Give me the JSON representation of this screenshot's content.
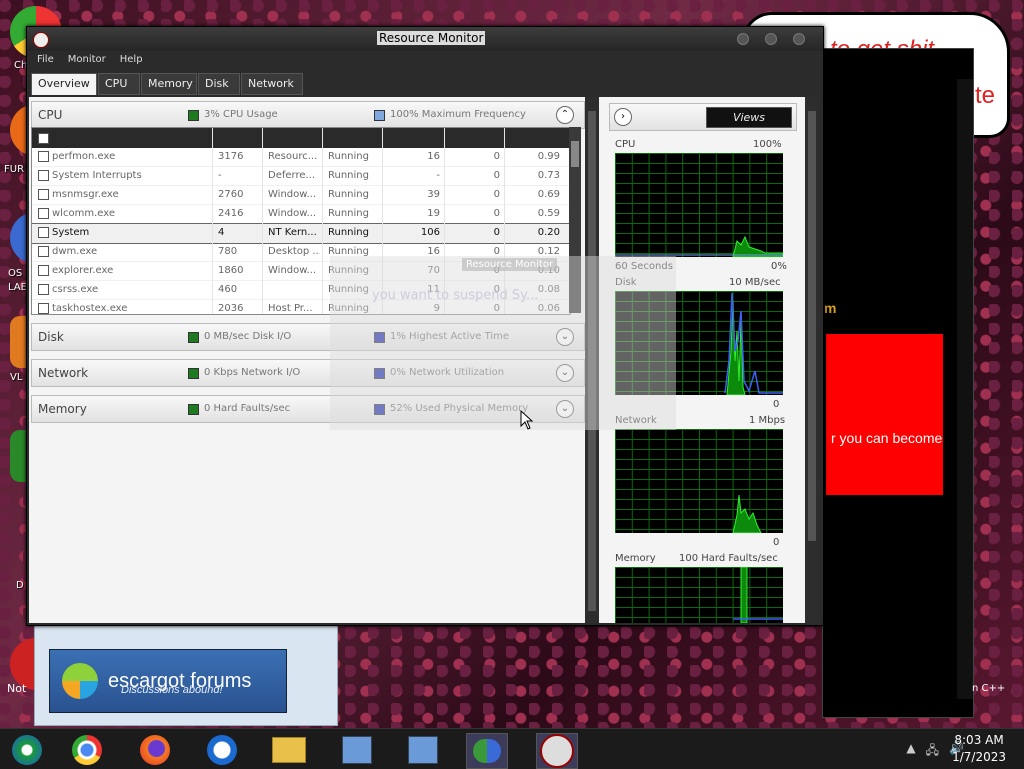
{
  "desktop": {
    "labels": [
      "Ch",
      "FUR",
      "OS",
      "LAE",
      "VL",
      "D",
      "Not"
    ],
    "speech_text": "to get shit",
    "speech_te": "te",
    "yellow_text": "m",
    "red_box_text": "r you can become",
    "forum_title": "escargot forums",
    "forum_subtitle": "Discussions abound!",
    "cpp_label": "n C++"
  },
  "window": {
    "title": "Resource Monitor",
    "menu": [
      "File",
      "Monitor",
      "Help"
    ],
    "tabs": [
      "Overview",
      "CPU",
      "Memory",
      "Disk",
      "Network"
    ],
    "active_tab": "Overview"
  },
  "cpu_section": {
    "name": "CPU",
    "stat1": "3% CPU Usage",
    "stat1_color": "#1e7a1e",
    "stat2": "100% Maximum Frequency",
    "stat2_color": "#7fa8e0"
  },
  "processes": [
    {
      "name": "perfmon.exe",
      "pid": "3176",
      "desc": "Resourc...",
      "status": "Running",
      "threads": "16",
      "cpu": "0",
      "avg": "0.99"
    },
    {
      "name": "System Interrupts",
      "pid": "-",
      "desc": "Deferre...",
      "status": "Running",
      "threads": "-",
      "cpu": "0",
      "avg": "0.73"
    },
    {
      "name": "msnmsgr.exe",
      "pid": "2760",
      "desc": "Window...",
      "status": "Running",
      "threads": "39",
      "cpu": "0",
      "avg": "0.69"
    },
    {
      "name": "wlcomm.exe",
      "pid": "2416",
      "desc": "Window...",
      "status": "Running",
      "threads": "19",
      "cpu": "0",
      "avg": "0.59"
    },
    {
      "name": "System",
      "pid": "4",
      "desc": "NT Kern...",
      "status": "Running",
      "threads": "106",
      "cpu": "0",
      "avg": "0.20"
    },
    {
      "name": "dwm.exe",
      "pid": "780",
      "desc": "Desktop ...",
      "status": "Running",
      "threads": "16",
      "cpu": "0",
      "avg": "0.12"
    },
    {
      "name": "explorer.exe",
      "pid": "1860",
      "desc": "Window...",
      "status": "Running",
      "threads": "70",
      "cpu": "0",
      "avg": "0.10"
    },
    {
      "name": "csrss.exe",
      "pid": "460",
      "desc": "",
      "status": "Running",
      "threads": "11",
      "cpu": "0",
      "avg": "0.08"
    },
    {
      "name": "taskhostex.exe",
      "pid": "2036",
      "desc": "Host Pr...",
      "status": "Running",
      "threads": "9",
      "cpu": "0",
      "avg": "0.06"
    }
  ],
  "disk_section": {
    "name": "Disk",
    "stat1": "0 MB/sec Disk I/O",
    "stat1_color": "#1e7a1e",
    "stat2": "1% Highest Active Time",
    "stat2_color": "#1a2ab0"
  },
  "network_section": {
    "name": "Network",
    "stat1": "0 Kbps Network I/O",
    "stat1_color": "#1e7a1e",
    "stat2": "0% Network Utilization",
    "stat2_color": "#1a2ab0"
  },
  "memory_section": {
    "name": "Memory",
    "stat1": "0 Hard Faults/sec",
    "stat1_color": "#1e7a1e",
    "stat2": "52% Used Physical Memory",
    "stat2_color": "#1a2ab0"
  },
  "ghost_overlay": {
    "button": "Resource Monitor",
    "text": "you want to suspend Sy..."
  },
  "right_pane": {
    "views_label": "Views",
    "graphs": [
      {
        "name": "CPU",
        "max": "100%",
        "bottom_left": "60 Seconds",
        "bottom_right": "0%"
      },
      {
        "name": "Disk",
        "max": "10 MB/sec",
        "bottom_left": "",
        "bottom_right": "0"
      },
      {
        "name": "Network",
        "max": "1 Mbps",
        "bottom_left": "",
        "bottom_right": "0"
      },
      {
        "name": "Memory",
        "max": "100 Hard Faults/sec",
        "bottom_left": "",
        "bottom_right": ""
      }
    ]
  },
  "taskbar": {
    "items": [
      "windows-media-center",
      "chrome",
      "firefox",
      "msn",
      "file-explorer",
      "network-app-1",
      "network-app-2",
      "windows-live-messenger",
      "resource-monitor"
    ],
    "time": "8:03 AM",
    "date": "1/7/2023"
  }
}
